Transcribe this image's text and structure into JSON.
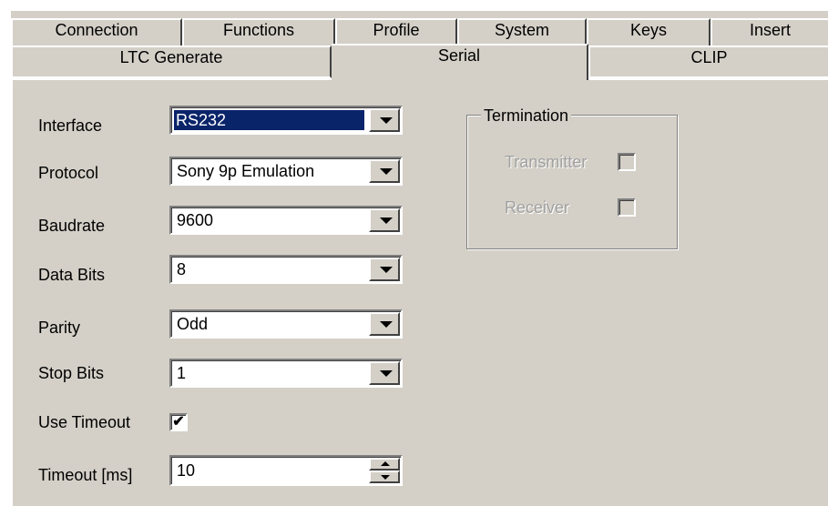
{
  "tabs_back": [
    {
      "label": "Connection"
    },
    {
      "label": "Functions"
    },
    {
      "label": "Profile"
    },
    {
      "label": "System"
    },
    {
      "label": "Keys"
    },
    {
      "label": "Insert"
    }
  ],
  "tabs_front": [
    {
      "label": "LTC Generate"
    },
    {
      "label": "Serial"
    },
    {
      "label": "CLIP"
    }
  ],
  "form": {
    "interface": {
      "label": "Interface",
      "value": "RS232"
    },
    "protocol": {
      "label": "Protocol",
      "value": "Sony 9p Emulation"
    },
    "baudrate": {
      "label": "Baudrate",
      "value": "9600"
    },
    "data_bits": {
      "label": "Data Bits",
      "value": "8"
    },
    "parity": {
      "label": "Parity",
      "value": "Odd"
    },
    "stop_bits": {
      "label": "Stop Bits",
      "value": "1"
    },
    "use_timeout": {
      "label": "Use Timeout",
      "checked": true,
      "mark": "✔"
    },
    "timeout": {
      "label": "Timeout [ms]",
      "value": "10"
    }
  },
  "termination": {
    "title": "Termination",
    "transmitter": {
      "label": "Transmitter",
      "checked": false
    },
    "receiver": {
      "label": "Receiver",
      "checked": false
    }
  },
  "icons": {
    "dropdown": "chevron-down-icon",
    "spin_up": "spin-up-icon",
    "spin_down": "spin-down-icon",
    "check": "check-icon"
  }
}
